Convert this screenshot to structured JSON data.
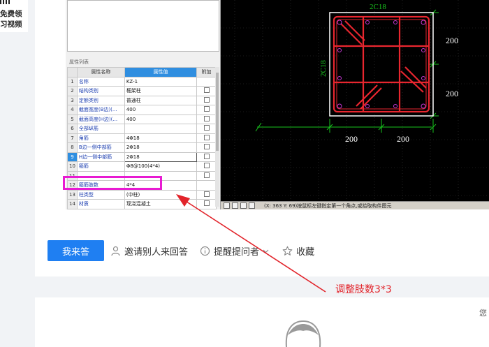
{
  "promo": {
    "line1": "免费领",
    "line2": "习视频"
  },
  "software": {
    "panel_title": "属性列表",
    "headers": [
      "属性名称",
      "属性值",
      "附加"
    ],
    "rows": [
      {
        "num": "1",
        "name": "名称",
        "value": "KZ-1",
        "checkbox": false
      },
      {
        "num": "2",
        "name": "结构类别",
        "value": "框架柱",
        "checkbox": true
      },
      {
        "num": "3",
        "name": "定额类别",
        "value": "普通柱",
        "checkbox": true
      },
      {
        "num": "4",
        "name": "截面宽度(B边)(...",
        "value": "400",
        "checkbox": true
      },
      {
        "num": "5",
        "name": "截面高度(H边)(...",
        "value": "400",
        "checkbox": true
      },
      {
        "num": "6",
        "name": "全部纵筋",
        "value": "",
        "checkbox": true
      },
      {
        "num": "7",
        "name": "角筋",
        "value": "4Φ18",
        "checkbox": true
      },
      {
        "num": "8",
        "name": "B边一侧中部筋",
        "value": "2Φ18",
        "checkbox": true
      },
      {
        "num": "9",
        "name": "H边一侧中部筋",
        "value": "2Φ18",
        "checkbox": true
      },
      {
        "num": "10",
        "name": "箍筋",
        "value": "Φ8@100(4*4)",
        "checkbox": true
      },
      {
        "num": "11",
        "name": "",
        "value": "",
        "checkbox": true
      },
      {
        "num": "12",
        "name": "箍筋肢数",
        "value": "4*4",
        "checkbox": false
      },
      {
        "num": "13",
        "name": "柱类型",
        "value": "(中柱)",
        "checkbox": true
      },
      {
        "num": "14",
        "name": "材质",
        "value": "现浇混凝土",
        "checkbox": true
      }
    ],
    "cad": {
      "top_label": "2C18",
      "left_label": "2C18",
      "right_dim_1": "200",
      "right_dim_2": "200",
      "bottom_dim_1": "200",
      "bottom_dim_2": "200"
    },
    "status_text": "(X: 363 Y: 69)按鼠标左键指定第一个角点,或拾取构件图元"
  },
  "actions": {
    "answer_button": "我来答",
    "invite": "邀请别人来回答",
    "remind": "提醒提问者",
    "favorite": "收藏"
  },
  "annotation": "调整肢数3*3",
  "colors": {
    "accent": "#1f7ff2",
    "highlight": "#e81bd2",
    "annotation": "#e2232a",
    "cad_red": "#e8262f",
    "cad_green": "#19c41e"
  },
  "lower_card": {
    "edge_char": "您"
  }
}
